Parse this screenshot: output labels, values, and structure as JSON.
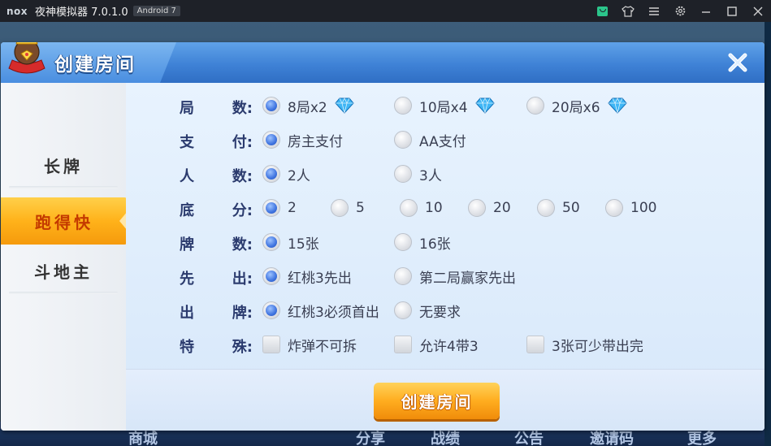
{
  "window": {
    "logo": "nox",
    "title": "夜神模拟器 7.0.1.0",
    "android": "Android 7",
    "icons": [
      "store-icon",
      "shirt-icon",
      "menu-icon",
      "settings-icon",
      "minimize-icon",
      "maximize-icon",
      "close-icon"
    ]
  },
  "dialog": {
    "title": "创建房间",
    "sidebar": [
      {
        "label": "长牌"
      },
      {
        "label": "跑得快"
      },
      {
        "label": "斗地主"
      }
    ],
    "rows": [
      {
        "label": [
          "局",
          "数:"
        ],
        "options": [
          {
            "text": "8局x2",
            "checked": true,
            "gem": true
          },
          {
            "text": "10局x4",
            "checked": false,
            "gem": true
          },
          {
            "text": "20局x6",
            "checked": false,
            "gem": true
          }
        ]
      },
      {
        "label": [
          "支",
          "付:"
        ],
        "options": [
          {
            "text": "房主支付",
            "checked": true
          },
          {
            "text": "AA支付",
            "checked": false
          }
        ]
      },
      {
        "label": [
          "人",
          "数:"
        ],
        "options": [
          {
            "text": "2人",
            "checked": true
          },
          {
            "text": "3人",
            "checked": false
          }
        ]
      },
      {
        "label": [
          "底",
          "分:"
        ],
        "options": [
          {
            "text": "2",
            "checked": true
          },
          {
            "text": "5",
            "checked": false
          },
          {
            "text": "10",
            "checked": false
          },
          {
            "text": "20",
            "checked": false
          },
          {
            "text": "50",
            "checked": false
          },
          {
            "text": "100",
            "checked": false
          }
        ]
      },
      {
        "label": [
          "牌",
          "数:"
        ],
        "options": [
          {
            "text": "15张",
            "checked": true
          },
          {
            "text": "16张",
            "checked": false
          }
        ]
      },
      {
        "label": [
          "先",
          "出:"
        ],
        "options": [
          {
            "text": "红桃3先出",
            "checked": true
          },
          {
            "text": "第二局赢家先出",
            "checked": false
          }
        ]
      },
      {
        "label": [
          "出",
          "牌:"
        ],
        "options": [
          {
            "text": "红桃3必须首出",
            "checked": true
          },
          {
            "text": "无要求",
            "checked": false
          }
        ]
      },
      {
        "label": [
          "特",
          "殊:"
        ],
        "type": "checkbox",
        "options": [
          {
            "text": "炸弹不可拆",
            "checked": false
          },
          {
            "text": "允许4带3",
            "checked": false
          },
          {
            "text": "3张可少带出完",
            "checked": false
          }
        ]
      }
    ],
    "create_button": "创建房间"
  },
  "background_nav": [
    "商城",
    "分享",
    "战绩",
    "公告",
    "邀请码",
    "更多"
  ]
}
